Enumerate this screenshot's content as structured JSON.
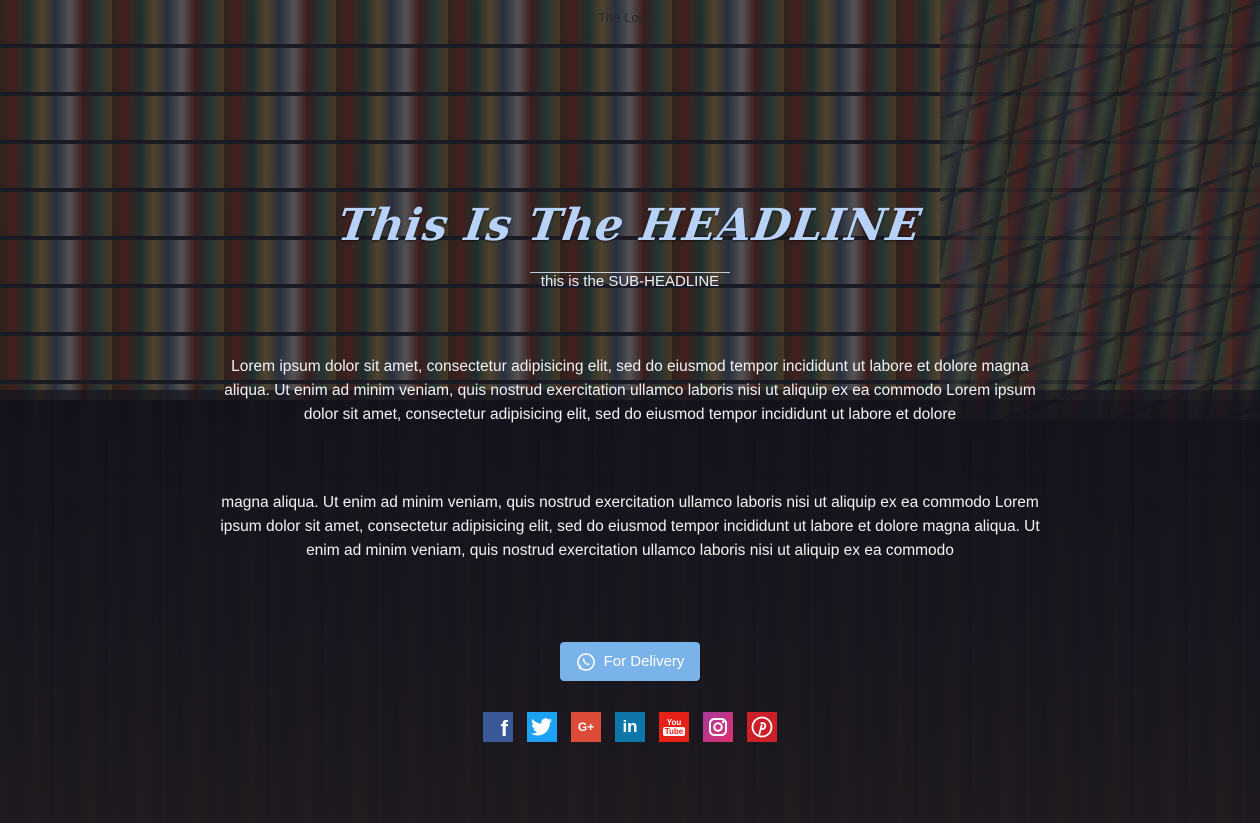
{
  "logo": {
    "text": "The Logo"
  },
  "hero": {
    "headline": "This Is The HEADLINE",
    "subheadline": "this is the SUB-HEADLINE"
  },
  "body": {
    "paragraph_1": "Lorem ipsum dolor sit amet, consectetur adipisicing elit, sed do eiusmod tempor incididunt ut labore et dolore magna aliqua. Ut enim ad minim veniam, quis nostrud exercitation ullamco laboris nisi ut aliquip ex ea commodo Lorem ipsum dolor sit amet, consectetur adipisicing elit, sed do eiusmod tempor incididunt ut labore et dolore",
    "paragraph_2": "magna aliqua. Ut enim ad minim veniam, quis nostrud exercitation ullamco laboris nisi ut aliquip ex ea commodo Lorem ipsum dolor sit amet, consectetur adipisicing elit, sed do eiusmod tempor incididunt ut labore et dolore magna aliqua. Ut enim ad minim veniam, quis nostrud exercitation ullamco laboris nisi ut aliquip ex ea commodo"
  },
  "cta": {
    "label": "For Delivery",
    "icon": "whatsapp-icon",
    "color": "#7ab2ea"
  },
  "social": [
    {
      "name": "facebook",
      "icon": "facebook-icon",
      "color": "#3b5998"
    },
    {
      "name": "twitter",
      "icon": "twitter-icon",
      "color": "#1da1f2"
    },
    {
      "name": "google-plus",
      "icon": "google-plus-icon",
      "color": "#dd4b39"
    },
    {
      "name": "linkedin",
      "icon": "linkedin-icon",
      "color": "#0e76a8"
    },
    {
      "name": "youtube",
      "icon": "youtube-icon",
      "color": "#e62117"
    },
    {
      "name": "instagram",
      "icon": "instagram-icon",
      "color": "#c13584"
    },
    {
      "name": "pinterest",
      "icon": "pinterest-icon",
      "color": "#cb2027"
    }
  ]
}
